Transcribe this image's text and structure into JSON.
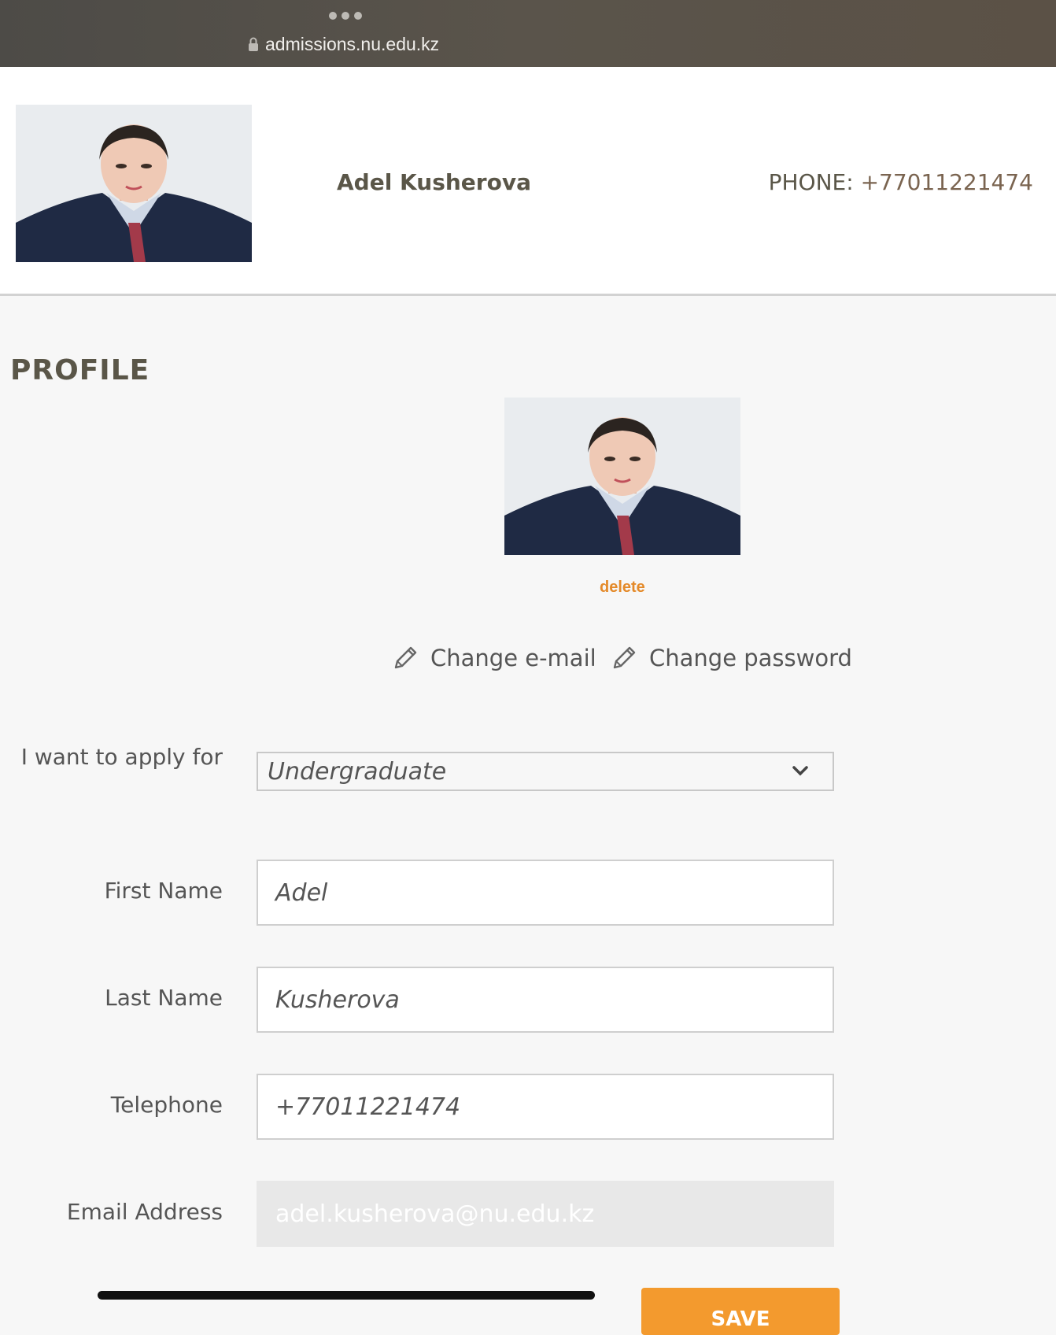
{
  "browser": {
    "url": "admissions.nu.edu.kz"
  },
  "header": {
    "name": "Adel Kusherova",
    "phone_label": "PHONE:",
    "phone_value": "+77011221474"
  },
  "profile": {
    "title": "PROFILE",
    "delete_label": "delete",
    "change_email_label": "Change e-mail",
    "change_password_label": "Change password"
  },
  "form": {
    "apply_label": "I want to apply for",
    "apply_value": "Undergraduate",
    "first_name_label": "First Name",
    "first_name_value": "Adel",
    "last_name_label": "Last Name",
    "last_name_value": "Kusherova",
    "telephone_label": "Telephone",
    "telephone_value": "+77011221474",
    "email_label": "Email Address",
    "email_value": "adel.kusherova@nu.edu.kz",
    "save_label": "SAVE"
  },
  "colors": {
    "accent": "#f39a2e",
    "link": "#e48a2a",
    "text": "#555555",
    "heading": "#5a5648"
  }
}
